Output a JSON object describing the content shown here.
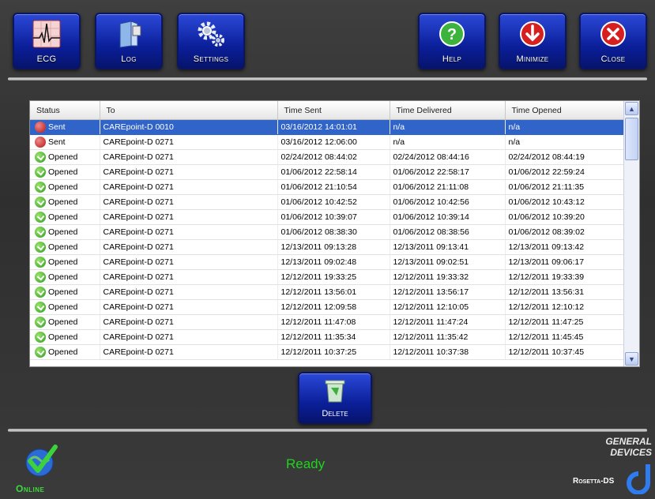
{
  "toolbar": {
    "ecg": "ECG",
    "log": "Log",
    "settings": "Settings",
    "help": "Help",
    "minimize": "Minimize",
    "close": "Close"
  },
  "table": {
    "headers": [
      "Status",
      "To",
      "Time Sent",
      "Time Delivered",
      "Time Opened"
    ],
    "rows": [
      {
        "status": "Sent",
        "to": "CAREpoint-D 0010",
        "sent": "03/16/2012 14:01:01",
        "delivered": "n/a",
        "opened": "n/a"
      },
      {
        "status": "Sent",
        "to": "CAREpoint-D 0271",
        "sent": "03/16/2012 12:06:00",
        "delivered": "n/a",
        "opened": "n/a"
      },
      {
        "status": "Opened",
        "to": "CAREpoint-D 0271",
        "sent": "02/24/2012 08:44:02",
        "delivered": "02/24/2012 08:44:16",
        "opened": "02/24/2012 08:44:19"
      },
      {
        "status": "Opened",
        "to": "CAREpoint-D 0271",
        "sent": "01/06/2012 22:58:14",
        "delivered": "01/06/2012 22:58:17",
        "opened": "01/06/2012 22:59:24"
      },
      {
        "status": "Opened",
        "to": "CAREpoint-D 0271",
        "sent": "01/06/2012 21:10:54",
        "delivered": "01/06/2012 21:11:08",
        "opened": "01/06/2012 21:11:35"
      },
      {
        "status": "Opened",
        "to": "CAREpoint-D 0271",
        "sent": "01/06/2012 10:42:52",
        "delivered": "01/06/2012 10:42:56",
        "opened": "01/06/2012 10:43:12"
      },
      {
        "status": "Opened",
        "to": "CAREpoint-D 0271",
        "sent": "01/06/2012 10:39:07",
        "delivered": "01/06/2012 10:39:14",
        "opened": "01/06/2012 10:39:20"
      },
      {
        "status": "Opened",
        "to": "CAREpoint-D 0271",
        "sent": "01/06/2012 08:38:30",
        "delivered": "01/06/2012 08:38:56",
        "opened": "01/06/2012 08:39:02"
      },
      {
        "status": "Opened",
        "to": "CAREpoint-D 0271",
        "sent": "12/13/2011 09:13:28",
        "delivered": "12/13/2011 09:13:41",
        "opened": "12/13/2011 09:13:42"
      },
      {
        "status": "Opened",
        "to": "CAREpoint-D 0271",
        "sent": "12/13/2011 09:02:48",
        "delivered": "12/13/2011 09:02:51",
        "opened": "12/13/2011 09:06:17"
      },
      {
        "status": "Opened",
        "to": "CAREpoint-D 0271",
        "sent": "12/12/2011 19:33:25",
        "delivered": "12/12/2011 19:33:32",
        "opened": "12/12/2011 19:33:39"
      },
      {
        "status": "Opened",
        "to": "CAREpoint-D 0271",
        "sent": "12/12/2011 13:56:01",
        "delivered": "12/12/2011 13:56:17",
        "opened": "12/12/2011 13:56:31"
      },
      {
        "status": "Opened",
        "to": "CAREpoint-D 0271",
        "sent": "12/12/2011 12:09:58",
        "delivered": "12/12/2011 12:10:05",
        "opened": "12/12/2011 12:10:12"
      },
      {
        "status": "Opened",
        "to": "CAREpoint-D 0271",
        "sent": "12/12/2011 11:47:08",
        "delivered": "12/12/2011 11:47:24",
        "opened": "12/12/2011 11:47:25"
      },
      {
        "status": "Opened",
        "to": "CAREpoint-D 0271",
        "sent": "12/12/2011 11:35:34",
        "delivered": "12/12/2011 11:35:42",
        "opened": "12/12/2011 11:45:45"
      },
      {
        "status": "Opened",
        "to": "CAREpoint-D 0271",
        "sent": "12/12/2011 10:37:25",
        "delivered": "12/12/2011 10:37:38",
        "opened": "12/12/2011 10:37:45"
      }
    ]
  },
  "delete_label": "Delete",
  "status_text": "Ready",
  "online_label": "Online",
  "brand": {
    "line1": "GENERAL",
    "line2": "DEVICES",
    "product": "Rosetta-DS"
  },
  "colors": {
    "button_blue": "#0b1f9a",
    "ready_green": "#1fd41f",
    "selection": "#3164c9"
  }
}
